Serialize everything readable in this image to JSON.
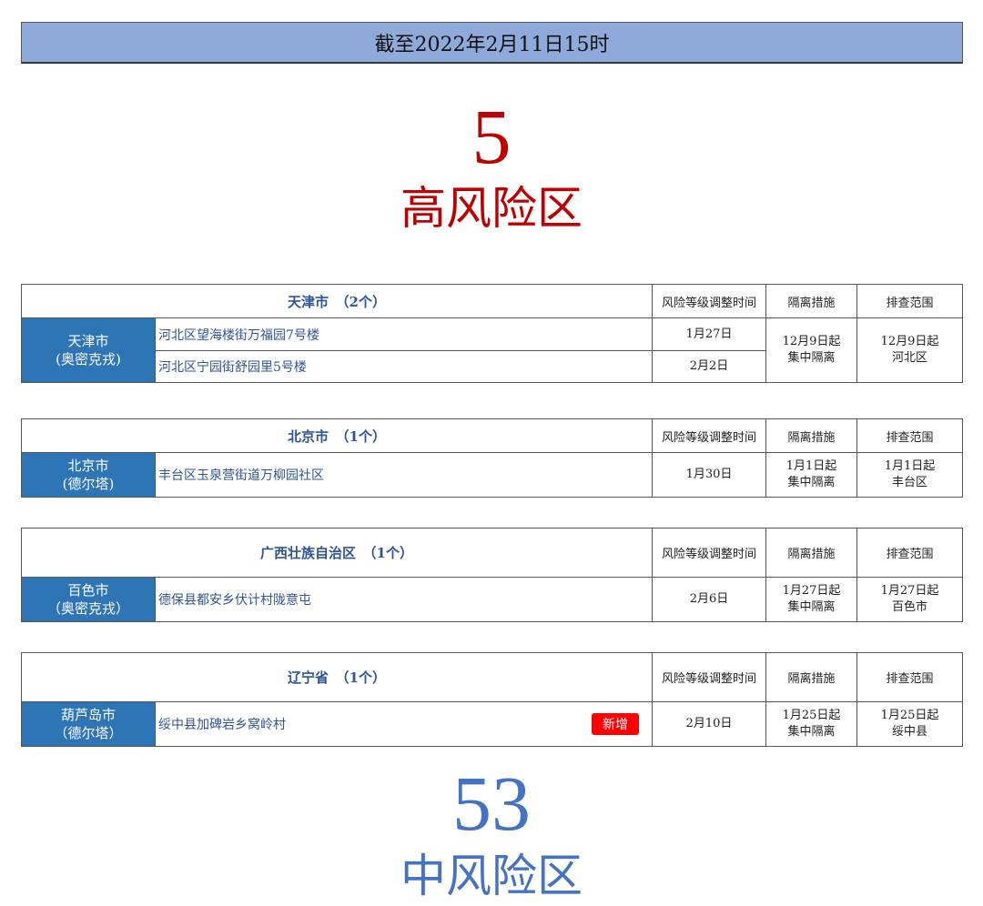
{
  "banner": {
    "text": "截至2022年2月11日15时"
  },
  "high_risk": {
    "count": "5",
    "label": "高风险区",
    "color": "#c00000"
  },
  "mid_risk": {
    "count": "53",
    "label": "中风险区",
    "color": "#4472c4"
  },
  "columns": {
    "time": "风险等级调整时间",
    "isolation": "隔离措施",
    "screening": "排查范围"
  },
  "regions": [
    {
      "province": "天津市　（2个）",
      "city": [
        "天津市",
        "(奥密克戎)"
      ],
      "areas": [
        {
          "address": "河北区望海楼街万福园7号楼",
          "time": "1月27日"
        },
        {
          "address": "河北区宁园街舒园里5号楼",
          "time": "2月2日"
        }
      ],
      "isolation": [
        "12月9日起",
        "集中隔离"
      ],
      "screening": [
        "12月9日起",
        "河北区"
      ]
    },
    {
      "province": "北京市　（1个）",
      "city": [
        "北京市",
        "(德尔塔)"
      ],
      "areas": [
        {
          "address": "丰台区玉泉营街道万柳园社区",
          "time": "1月30日"
        }
      ],
      "isolation": [
        "1月1日起",
        "集中隔离"
      ],
      "screening": [
        "1月1日起",
        "丰台区"
      ]
    },
    {
      "province": "广西壮族自治区　（1个）",
      "city": [
        "百色市",
        "（奥密克戎）"
      ],
      "areas": [
        {
          "address": "德保县都安乡伏计村陇意屯",
          "time": "2月6日"
        }
      ],
      "isolation": [
        "1月27日起",
        "集中隔离"
      ],
      "screening": [
        "1月27日起",
        "百色市"
      ]
    },
    {
      "province": "辽宁省　（1个）",
      "city": [
        "葫芦岛市",
        "（德尔塔）"
      ],
      "areas": [
        {
          "address": "绥中县加碑岩乡窝岭村",
          "time": "2月10日",
          "badge": "新增"
        }
      ],
      "isolation": [
        "1月25日起",
        "集中隔离"
      ],
      "screening": [
        "1月25日起",
        "绥中县"
      ]
    }
  ]
}
